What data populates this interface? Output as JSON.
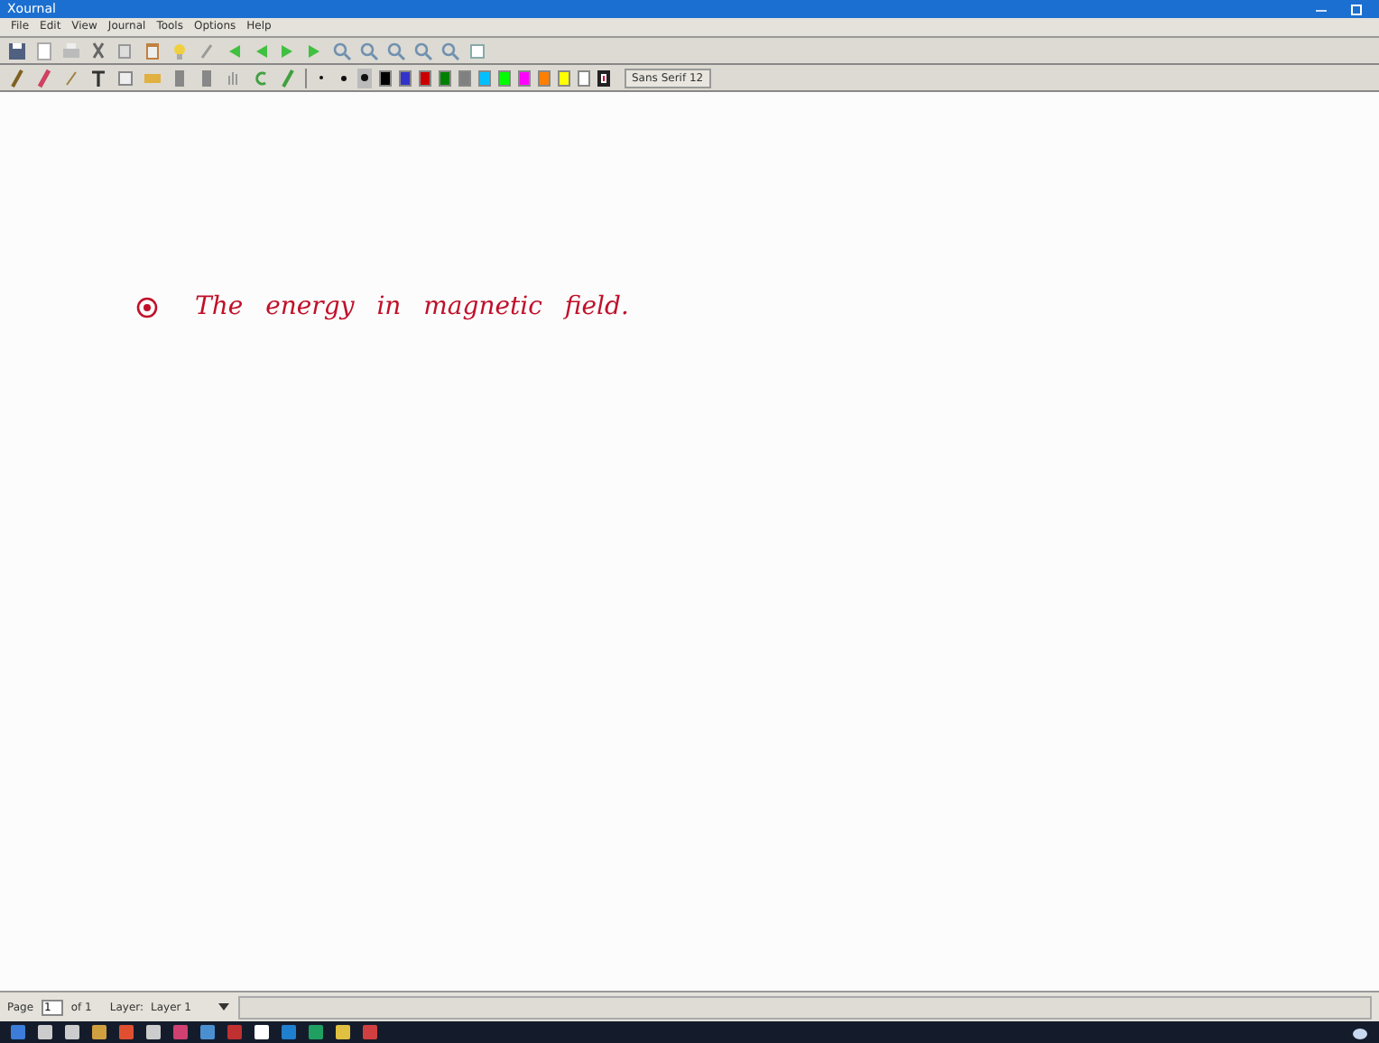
{
  "window": {
    "title": "Xournal"
  },
  "menu": [
    "File",
    "Edit",
    "View",
    "Journal",
    "Tools",
    "Options",
    "Help"
  ],
  "pen_toolbar": {
    "thickness": [
      {
        "selected": false
      },
      {
        "selected": false
      },
      {
        "selected": true
      }
    ],
    "colors": [
      {
        "color": "#000000",
        "selected": false
      },
      {
        "color": "#3333cc",
        "selected": false
      },
      {
        "color": "#cc0000",
        "selected": false
      },
      {
        "color": "#008000",
        "selected": false
      },
      {
        "color": "#808080",
        "selected": false
      },
      {
        "color": "#00c0ff",
        "selected": false
      },
      {
        "color": "#00ff00",
        "selected": false
      },
      {
        "color": "#ff00ff",
        "selected": false
      },
      {
        "color": "#ff8000",
        "selected": false
      },
      {
        "color": "#ffff00",
        "selected": false
      },
      {
        "color": "#ffffff",
        "selected": false
      },
      {
        "color": "#dd0022",
        "selected": true
      }
    ],
    "font": "Sans Serif 12"
  },
  "page": {
    "note": "The energy in magnetic field."
  },
  "status_bar": {
    "page_label": "Page",
    "page": "1",
    "of": "of 1",
    "layer_label": "Layer:",
    "layer": "Layer 1"
  }
}
